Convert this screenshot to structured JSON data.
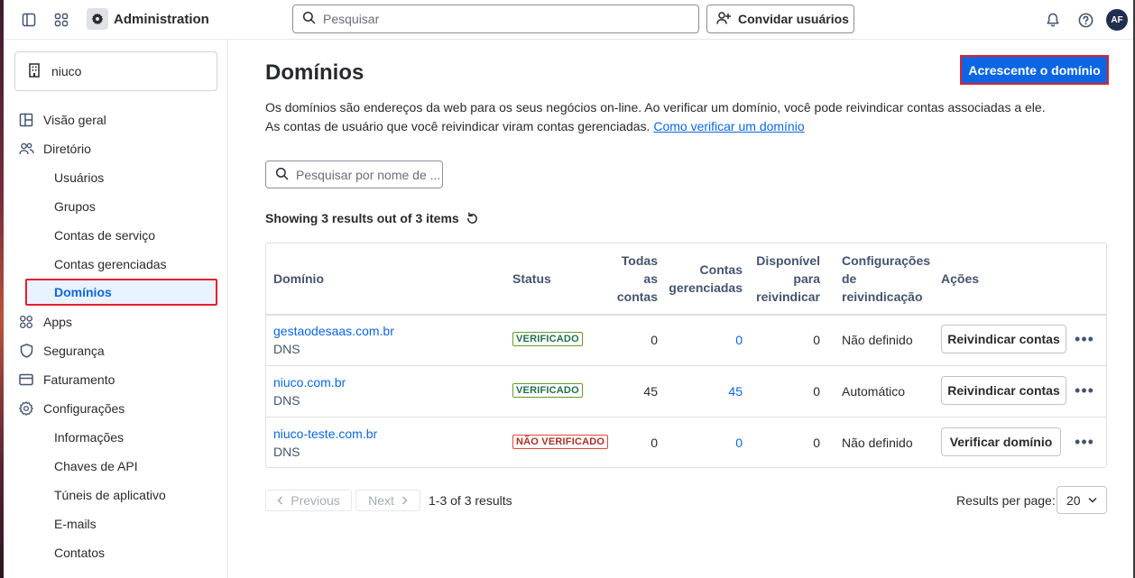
{
  "topbar": {
    "app_title": "Administration",
    "search_placeholder": "Pesquisar",
    "invite_label": "Convidar usuários",
    "avatar_initials": "AF"
  },
  "sidebar": {
    "org_name": "niuco",
    "items": [
      {
        "label": "Visão geral",
        "icon": "layout-icon"
      },
      {
        "label": "Diretório",
        "icon": "people-icon"
      },
      {
        "label": "Usuários"
      },
      {
        "label": "Grupos"
      },
      {
        "label": "Contas de serviço"
      },
      {
        "label": "Contas gerenciadas"
      },
      {
        "label": "Domínios",
        "active": true
      },
      {
        "label": "Apps",
        "icon": "apps-icon"
      },
      {
        "label": "Segurança",
        "icon": "shield-icon"
      },
      {
        "label": "Faturamento",
        "icon": "credit-card-icon"
      },
      {
        "label": "Configurações",
        "icon": "gear-icon"
      },
      {
        "label": "Informações"
      },
      {
        "label": "Chaves de API"
      },
      {
        "label": "Túneis de aplicativo"
      },
      {
        "label": "E-mails"
      },
      {
        "label": "Contatos"
      }
    ]
  },
  "main": {
    "title": "Domínios",
    "add_button": "Acrescente o domínio",
    "description": "Os domínios são endereços da web para os seus negócios on-line. Ao verificar um domínio, você pode reivindicar contas associadas a ele. As contas de usuário que você reivindicar viram contas gerenciadas.",
    "description_link": "Como verificar um domínio",
    "search_placeholder": "Pesquisar por nome de ...",
    "results_text": "Showing 3 results out of 3 items"
  },
  "table": {
    "headers": {
      "domain": "Domínio",
      "status": "Status",
      "all_1": "Todas",
      "all_2": "as",
      "all_3": "contas",
      "managed_1": "Contas",
      "managed_2": "gerenciadas",
      "avail_1": "Disponível",
      "avail_2": "para",
      "avail_3": "reivindicar",
      "claim_1": "Configurações",
      "claim_2": "de",
      "claim_3": "reivindicação",
      "actions": "Ações"
    },
    "rows": [
      {
        "domain": "gestaodesaas.com.br",
        "method": "DNS",
        "status": "VERIFICADO",
        "all": "0",
        "managed": "0",
        "available": "0",
        "claim": "Não definido",
        "action": "Reivindicar contas"
      },
      {
        "domain": "niuco.com.br",
        "method": "DNS",
        "status": "VERIFICADO",
        "all": "45",
        "managed": "45",
        "available": "0",
        "claim": "Automático",
        "action": "Reivindicar contas"
      },
      {
        "domain": "niuco-teste.com.br",
        "method": "DNS",
        "status": "NÃO VERIFICADO",
        "all": "0",
        "managed": "0",
        "available": "0",
        "claim": "Não definido",
        "action": "Verificar domínio"
      }
    ]
  },
  "pagination": {
    "previous": "Previous",
    "next": "Next",
    "summary": "1-3 of 3 results",
    "rpp_label": "Results per page:",
    "rpp_value": "20"
  },
  "colors": {
    "primary": "#0c66e4",
    "highlight_border": "#e2202e",
    "verified": "#216e4e",
    "unverified": "#ae2e24"
  }
}
